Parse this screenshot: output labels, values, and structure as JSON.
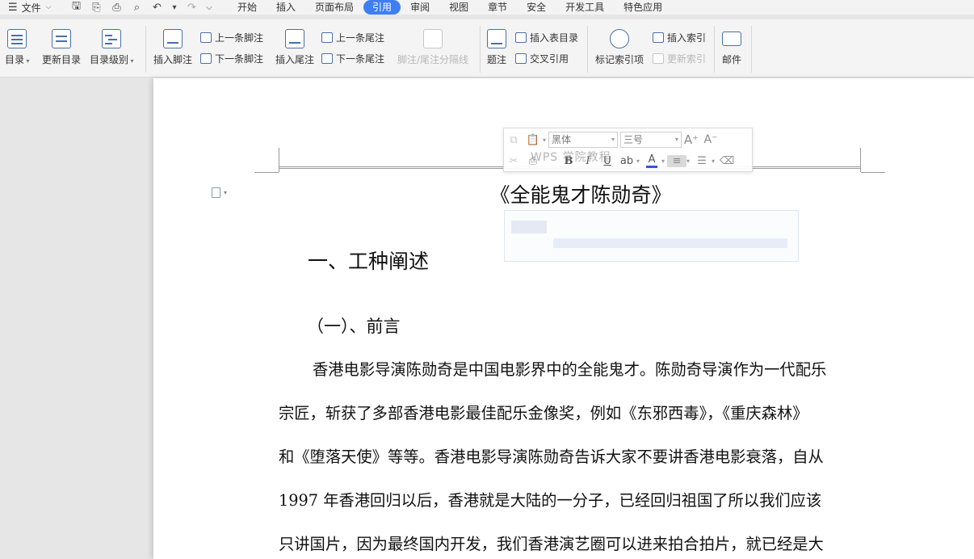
{
  "menubar": {
    "file_label": "文件",
    "tabs": [
      {
        "label": "开始"
      },
      {
        "label": "插入"
      },
      {
        "label": "页面布局"
      },
      {
        "label": "引用",
        "active": true
      },
      {
        "label": "审阅"
      },
      {
        "label": "视图"
      },
      {
        "label": "章节"
      },
      {
        "label": "安全"
      },
      {
        "label": "开发工具"
      },
      {
        "label": "特色应用"
      }
    ]
  },
  "ribbon": {
    "toc": "目录",
    "update_toc": "更新目录",
    "toc_level": "目录级别",
    "insert_footnote": "插入脚注",
    "prev_footnote": "上一条脚注",
    "next_footnote": "下一条脚注",
    "insert_endnote": "插入尾注",
    "prev_endnote": "上一条尾注",
    "next_endnote": "下一条尾注",
    "footnote_separator": "脚注/尾注分隔线",
    "caption": "题注",
    "insert_table_of_figures": "插入表目录",
    "cross_reference": "交叉引用",
    "mark_index_entry": "标记索引项",
    "insert_index": "插入索引",
    "update_index": "更新索引",
    "mail": "邮件"
  },
  "mini_toolbar": {
    "font": "黑体",
    "size": "三号"
  },
  "watermark": "WPS 学院教程",
  "document": {
    "title": "《全能鬼才陈勋奇》",
    "heading1": "一、工种阐述",
    "heading2": "（一）、前言",
    "lines": [
      "香港电影导演陈勋奇是中国电影界中的全能鬼才。陈勋奇导演作为一代配乐",
      "宗匠，斩获了多部香港电影最佳配乐金像奖，例如《东邪西毒》，《重庆森林》",
      "和《堕落天使》等等。香港电影导演陈勋奇告诉大家不要讲香港电影衰落，自从",
      "1997 年香港回归以后，香港就是大陆的一分子，已经回归祖国了所以我们应该",
      "只讲国片，因为最终国内开发，我们香港演艺圈可以进来拍合拍片，就已经是大"
    ]
  },
  "colors": {
    "accent": "#3d7ff2",
    "icon": "#4a6fa8"
  }
}
